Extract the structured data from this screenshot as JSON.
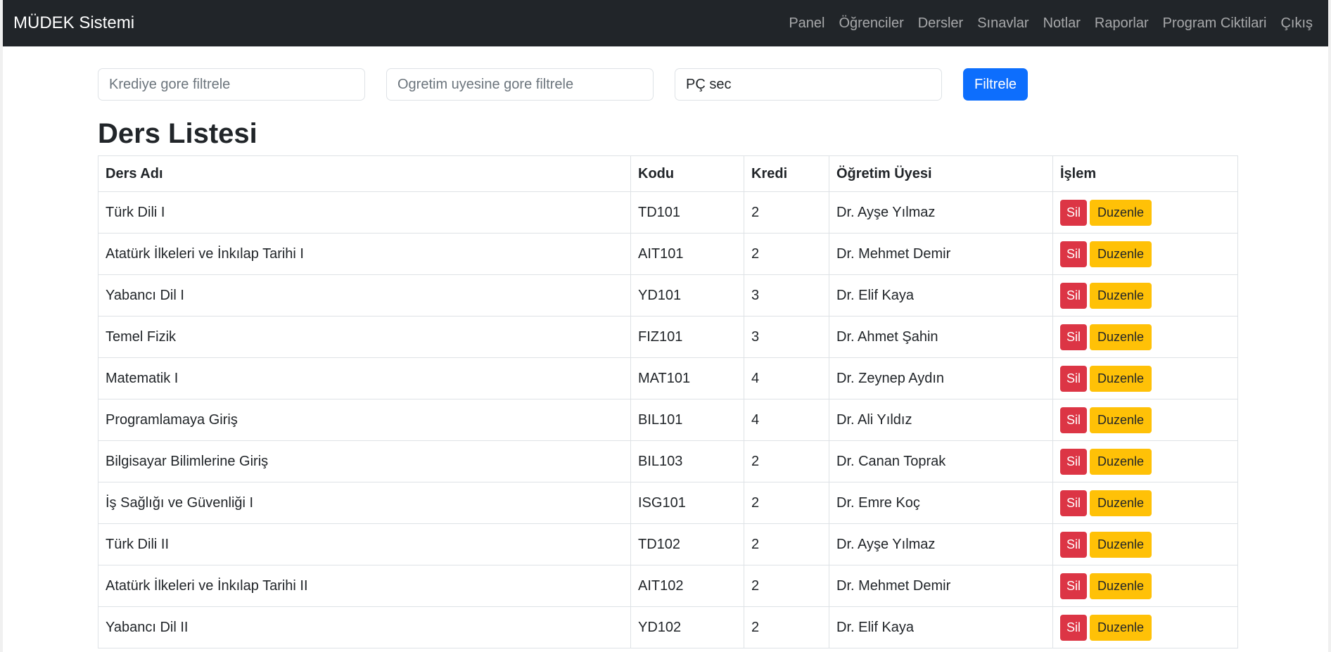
{
  "navbar": {
    "brand": "MÜDEK Sistemi",
    "links": [
      "Panel",
      "Öğrenciler",
      "Dersler",
      "Sınavlar",
      "Notlar",
      "Raporlar",
      "Program Ciktilari",
      "Çıkış"
    ]
  },
  "filters": {
    "credit_placeholder": "Krediye gore filtrele",
    "instructor_placeholder": "Ogretim uyesine gore filtrele",
    "pc_select_value": "PÇ sec",
    "filter_button": "Filtrele"
  },
  "page_title": "Ders Listesi",
  "table": {
    "headers": [
      "Ders Adı",
      "Kodu",
      "Kredi",
      "Öğretim Üyesi",
      "İşlem"
    ],
    "delete_label": "Sil",
    "edit_label": "Duzenle",
    "rows": [
      {
        "name": "Türk Dili I",
        "code": "TD101",
        "credit": "2",
        "instructor": "Dr. Ayşe Yılmaz"
      },
      {
        "name": "Atatürk İlkeleri ve İnkılap Tarihi I",
        "code": "AIT101",
        "credit": "2",
        "instructor": "Dr. Mehmet Demir"
      },
      {
        "name": "Yabancı Dil I",
        "code": "YD101",
        "credit": "3",
        "instructor": "Dr. Elif Kaya"
      },
      {
        "name": "Temel Fizik",
        "code": "FIZ101",
        "credit": "3",
        "instructor": "Dr. Ahmet Şahin"
      },
      {
        "name": "Matematik I",
        "code": "MAT101",
        "credit": "4",
        "instructor": "Dr. Zeynep Aydın"
      },
      {
        "name": "Programlamaya Giriş",
        "code": "BIL101",
        "credit": "4",
        "instructor": "Dr. Ali Yıldız"
      },
      {
        "name": "Bilgisayar Bilimlerine Giriş",
        "code": "BIL103",
        "credit": "2",
        "instructor": "Dr. Canan Toprak"
      },
      {
        "name": "İş Sağlığı ve Güvenliği I",
        "code": "ISG101",
        "credit": "2",
        "instructor": "Dr. Emre Koç"
      },
      {
        "name": "Türk Dili II",
        "code": "TD102",
        "credit": "2",
        "instructor": "Dr. Ayşe Yılmaz"
      },
      {
        "name": "Atatürk İlkeleri ve İnkılap Tarihi II",
        "code": "AIT102",
        "credit": "2",
        "instructor": "Dr. Mehmet Demir"
      },
      {
        "name": "Yabancı Dil II",
        "code": "YD102",
        "credit": "2",
        "instructor": "Dr. Elif Kaya"
      }
    ]
  },
  "colors": {
    "navbar_bg": "#212529",
    "primary": "#0d6efd",
    "danger": "#dc3545",
    "warning": "#ffc107"
  }
}
